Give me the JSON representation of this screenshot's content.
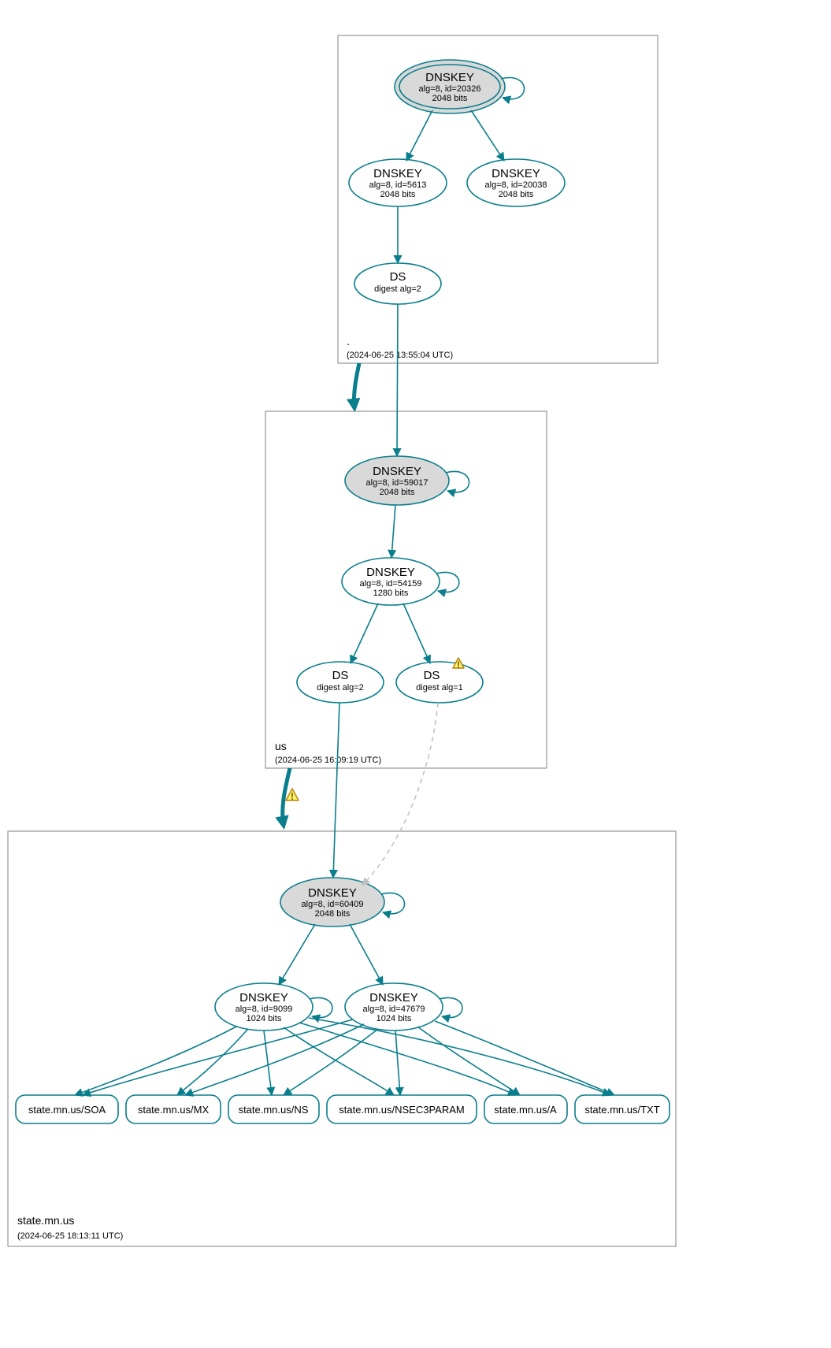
{
  "colors": {
    "accent": "#0a7e8c",
    "ksk_fill": "#d9d9d9",
    "warn": "#fff36a"
  },
  "zones": {
    "root": {
      "label": ".",
      "timestamp": "(2024-06-25 13:55:04 UTC)",
      "nodes": {
        "ksk": {
          "type": "DNSKEY",
          "line2": "alg=8, id=20326",
          "line3": "2048 bits",
          "ksk": true
        },
        "zsk1": {
          "type": "DNSKEY",
          "line2": "alg=8, id=5613",
          "line3": "2048 bits"
        },
        "zsk2": {
          "type": "DNSKEY",
          "line2": "alg=8, id=20038",
          "line3": "2048 bits"
        },
        "ds": {
          "type": "DS",
          "line2": "digest alg=2"
        }
      }
    },
    "us": {
      "label": "us",
      "timestamp": "(2024-06-25 16:09:19 UTC)",
      "nodes": {
        "ksk": {
          "type": "DNSKEY",
          "line2": "alg=8, id=59017",
          "line3": "2048 bits",
          "ksk": true
        },
        "zsk": {
          "type": "DNSKEY",
          "line2": "alg=8, id=54159",
          "line3": "1280 bits"
        },
        "ds1": {
          "type": "DS",
          "line2": "digest alg=2"
        },
        "ds2": {
          "type": "DS",
          "line2": "digest alg=1",
          "warn": true
        }
      }
    },
    "state": {
      "label": "state.mn.us",
      "timestamp": "(2024-06-25 18:13:11 UTC)",
      "nodes": {
        "ksk": {
          "type": "DNSKEY",
          "line2": "alg=8, id=60409",
          "line3": "2048 bits",
          "ksk": true
        },
        "zsk1": {
          "type": "DNSKEY",
          "line2": "alg=8, id=9099",
          "line3": "1024 bits"
        },
        "zsk2": {
          "type": "DNSKEY",
          "line2": "alg=8, id=47679",
          "line3": "1024 bits"
        }
      },
      "rrsets": [
        "state.mn.us/SOA",
        "state.mn.us/MX",
        "state.mn.us/NS",
        "state.mn.us/NSEC3PARAM",
        "state.mn.us/A",
        "state.mn.us/TXT"
      ]
    }
  },
  "edges": [
    {
      "from": "root.ksk",
      "to": "root.ksk",
      "selfloop": true
    },
    {
      "from": "root.ksk",
      "to": "root.zsk1"
    },
    {
      "from": "root.ksk",
      "to": "root.zsk2"
    },
    {
      "from": "root.zsk1",
      "to": "root.ds"
    },
    {
      "from": "root.ds",
      "to": "us.ksk"
    },
    {
      "from": "root",
      "to": "us",
      "zone_boundary": true
    },
    {
      "from": "us.ksk",
      "to": "us.ksk",
      "selfloop": true
    },
    {
      "from": "us.ksk",
      "to": "us.zsk"
    },
    {
      "from": "us.zsk",
      "to": "us.zsk",
      "selfloop": true
    },
    {
      "from": "us.zsk",
      "to": "us.ds1"
    },
    {
      "from": "us.zsk",
      "to": "us.ds2"
    },
    {
      "from": "us.ds1",
      "to": "state.ksk"
    },
    {
      "from": "us.ds2",
      "to": "state.ksk",
      "dashed": true
    },
    {
      "from": "us",
      "to": "state",
      "zone_boundary": true,
      "warn": true
    },
    {
      "from": "state.ksk",
      "to": "state.ksk",
      "selfloop": true
    },
    {
      "from": "state.ksk",
      "to": "state.zsk1"
    },
    {
      "from": "state.ksk",
      "to": "state.zsk2"
    },
    {
      "from": "state.zsk1",
      "to": "state.zsk1",
      "selfloop": true
    },
    {
      "from": "state.zsk2",
      "to": "state.zsk2",
      "selfloop": true
    },
    {
      "from": "state.zsk1",
      "to": "state.rr0"
    },
    {
      "from": "state.zsk1",
      "to": "state.rr1"
    },
    {
      "from": "state.zsk1",
      "to": "state.rr2"
    },
    {
      "from": "state.zsk1",
      "to": "state.rr3"
    },
    {
      "from": "state.zsk1",
      "to": "state.rr4"
    },
    {
      "from": "state.zsk1",
      "to": "state.rr5"
    },
    {
      "from": "state.zsk2",
      "to": "state.rr0"
    },
    {
      "from": "state.zsk2",
      "to": "state.rr1"
    },
    {
      "from": "state.zsk2",
      "to": "state.rr2"
    },
    {
      "from": "state.zsk2",
      "to": "state.rr3"
    },
    {
      "from": "state.zsk2",
      "to": "state.rr4"
    },
    {
      "from": "state.zsk2",
      "to": "state.rr5"
    }
  ]
}
